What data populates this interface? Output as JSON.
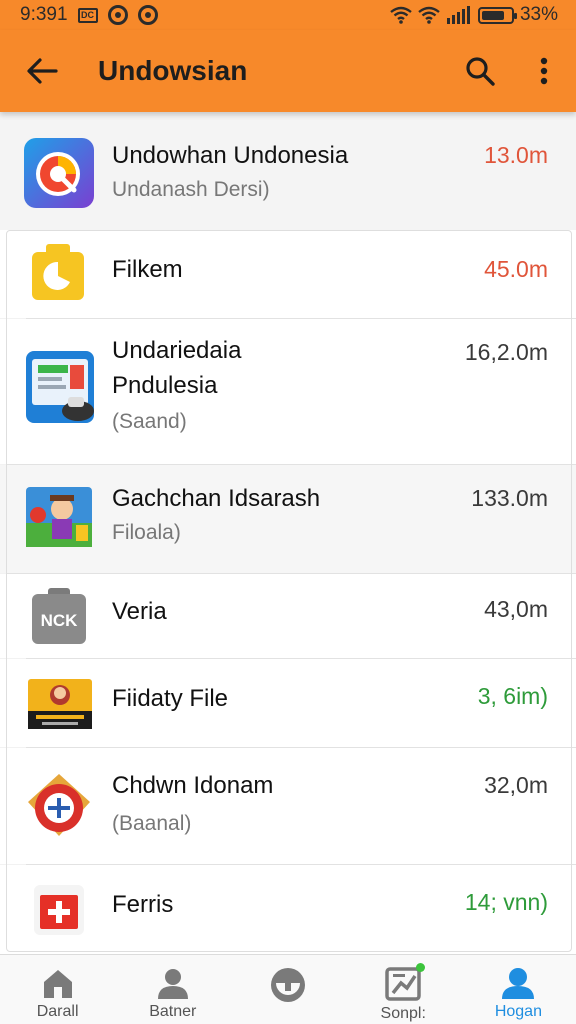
{
  "status_bar": {
    "time": "9:391",
    "badge": "DC",
    "battery_pct": "33%",
    "battery_level": 0.8
  },
  "app_bar": {
    "title": "Undowsian"
  },
  "colors": {
    "accent": "#f7892a",
    "size_red": "#e0553a",
    "size_green": "#2e9b3a",
    "size_dark": "#3a3a3a",
    "nav_active": "#1f8ee0"
  },
  "items": [
    {
      "name": "Undowhan Undonesia",
      "sub": "Undanash Dersi)",
      "size": "13.0m",
      "size_color": "#e0553a",
      "icon": "compass-chart-app-icon"
    },
    {
      "name": "Filkem",
      "sub": "",
      "size": "45.0m",
      "size_color": "#e0553a",
      "icon": "yellow-bag-icon"
    },
    {
      "name": "Undariedaia",
      "name2": "Pndulesia",
      "sub": "(Saand)",
      "size": "16,2.0m",
      "size_color": "#3a3a3a",
      "icon": "tablet-document-icon"
    },
    {
      "name": "Gachchan Idsarash",
      "sub": "Filoala)",
      "size": "133.0m",
      "size_color": "#3a3a3a",
      "icon": "game-character-icon"
    },
    {
      "name": "Veria",
      "sub": "",
      "size": "43,0m",
      "size_color": "#3a3a3a",
      "icon": "nck-bag-icon"
    },
    {
      "name": "Fiidaty File",
      "sub": "",
      "size": "3, 6im)",
      "size_color": "#2e9b3a",
      "icon": "movie-poster-icon"
    },
    {
      "name": "Chdwn Idonam",
      "sub": "(Baanal)",
      "size": "32,0m",
      "size_color": "#3a3a3a",
      "icon": "shield-emblem-icon"
    },
    {
      "name": "Ferris",
      "sub": "",
      "size": "14; vnn)",
      "size_color": "#2e9b3a",
      "icon": "red-cross-icon"
    }
  ],
  "bottom_nav": [
    {
      "label": "Darall",
      "icon": "home-icon"
    },
    {
      "label": "Batner",
      "icon": "person-icon"
    },
    {
      "label": "",
      "icon": "disc-icon"
    },
    {
      "label": "Sonpl:",
      "icon": "chart-icon"
    },
    {
      "label": "Hogan",
      "icon": "profile-icon",
      "active": true
    }
  ]
}
